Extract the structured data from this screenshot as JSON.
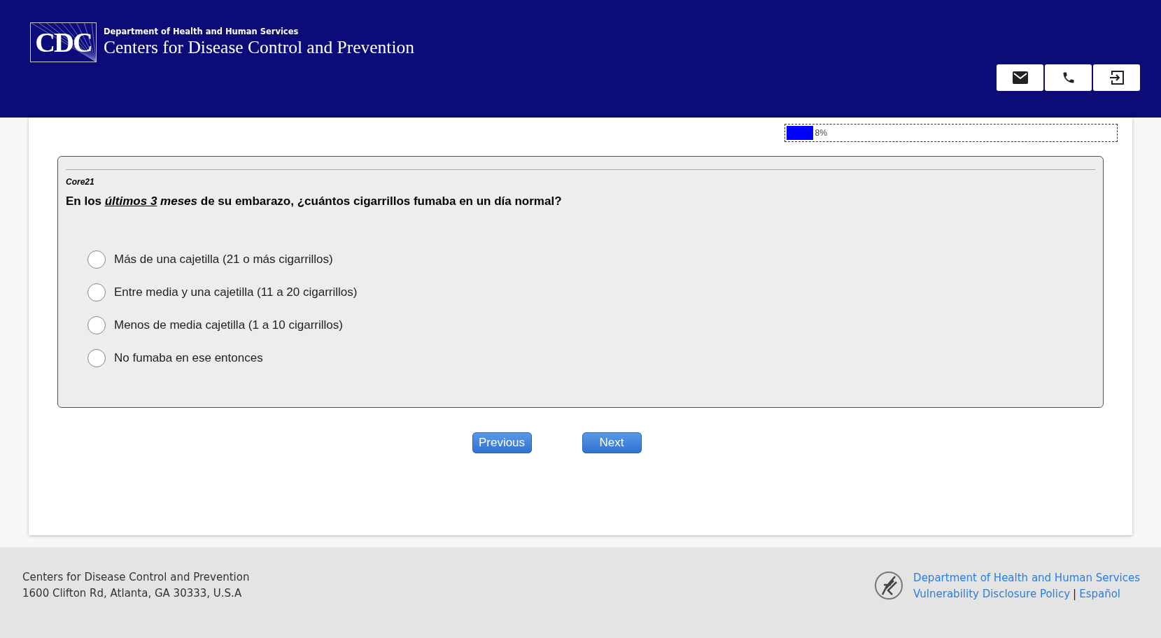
{
  "header": {
    "logo": "CDC",
    "department": "Department of Health and Human Services",
    "agency": "Centers for Disease Control and Prevention"
  },
  "header_buttons": [
    {
      "kind": "email"
    },
    {
      "kind": "phone"
    },
    {
      "kind": "exit"
    }
  ],
  "progress": {
    "level": 0.08,
    "reading": "8%"
  },
  "question": {
    "code": "Core21",
    "segments": [
      {
        "text": "En los ",
        "kind": "plain"
      },
      {
        "text": "últimos 3",
        "kind": "italic-underline"
      },
      {
        "text": " meses",
        "kind": "italic"
      },
      {
        "text": " de su embarazo, ¿cuántos cigarrillos fumaba en un día normal?",
        "kind": "plain"
      }
    ]
  },
  "options": [
    {
      "label": "Más de una cajetilla (21 o más cigarrillos)",
      "selected": false
    },
    {
      "label": "Entre media y una cajetilla (11 a 20 cigarrillos)",
      "selected": false
    },
    {
      "label": "Menos de media cajetilla (1 a 10 cigarrillos)",
      "selected": false
    },
    {
      "label": "No fumaba en ese entonces",
      "selected": false
    }
  ],
  "buttons": [
    "Previous",
    "Next"
  ],
  "footer": {
    "address_lines": [
      "Centers for Disease Control and Prevention",
      "1600 Clifton Rd, Atlanta, GA 30333, U.S.A"
    ],
    "links": [
      "Department of Health and Human Services",
      "Vulnerability Disclosure Policy"
    ],
    "separator": "|",
    "language_link": "Español"
  }
}
